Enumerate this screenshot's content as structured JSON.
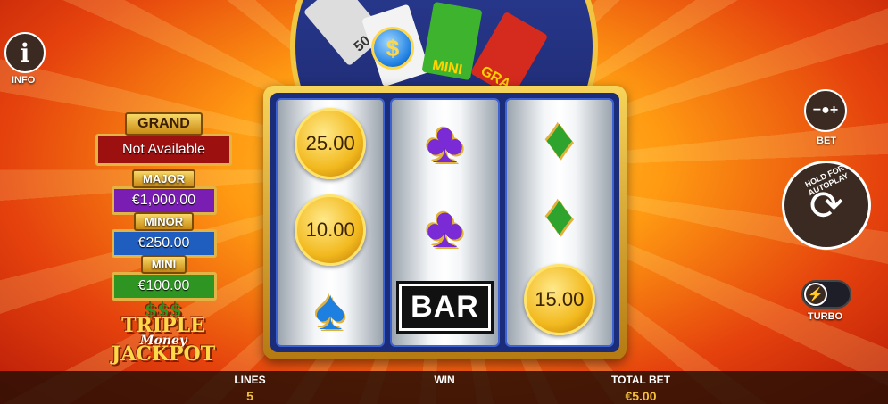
{
  "info": {
    "label": "INFO",
    "icon": "info-icon"
  },
  "jackpots": {
    "grand": {
      "title": "GRAND",
      "value": "Not Available"
    },
    "major": {
      "title": "MAJOR",
      "value": "€1,000.00"
    },
    "minor": {
      "title": "MINOR",
      "value": "€250.00"
    },
    "mini": {
      "title": "MINI",
      "value": "€100.00"
    }
  },
  "logo": {
    "dollars": "$$$",
    "line1": "TRIPLE",
    "line2": "Money",
    "line3": "JACKPOT"
  },
  "wheel": {
    "seg_mini": "MINI",
    "seg_grand": "GRA",
    "seg_white": "50"
  },
  "reels": [
    [
      {
        "kind": "coin",
        "value": "25.00"
      },
      {
        "kind": "coin",
        "value": "10.00"
      },
      {
        "kind": "spade"
      }
    ],
    [
      {
        "kind": "club"
      },
      {
        "kind": "club"
      },
      {
        "kind": "bar",
        "value": "BAR"
      }
    ],
    [
      {
        "kind": "diamond"
      },
      {
        "kind": "diamond"
      },
      {
        "kind": "coin",
        "value": "15.00"
      }
    ]
  ],
  "controls": {
    "bet_label": "BET",
    "autoplay_label": "HOLD FOR AUTOPLAY",
    "turbo_label": "TURBO"
  },
  "stats": {
    "lines_label": "LINES",
    "lines_value": "5",
    "win_label": "WIN",
    "win_value": "",
    "total_bet_label": "TOTAL BET",
    "total_bet_value": "€5.00"
  }
}
